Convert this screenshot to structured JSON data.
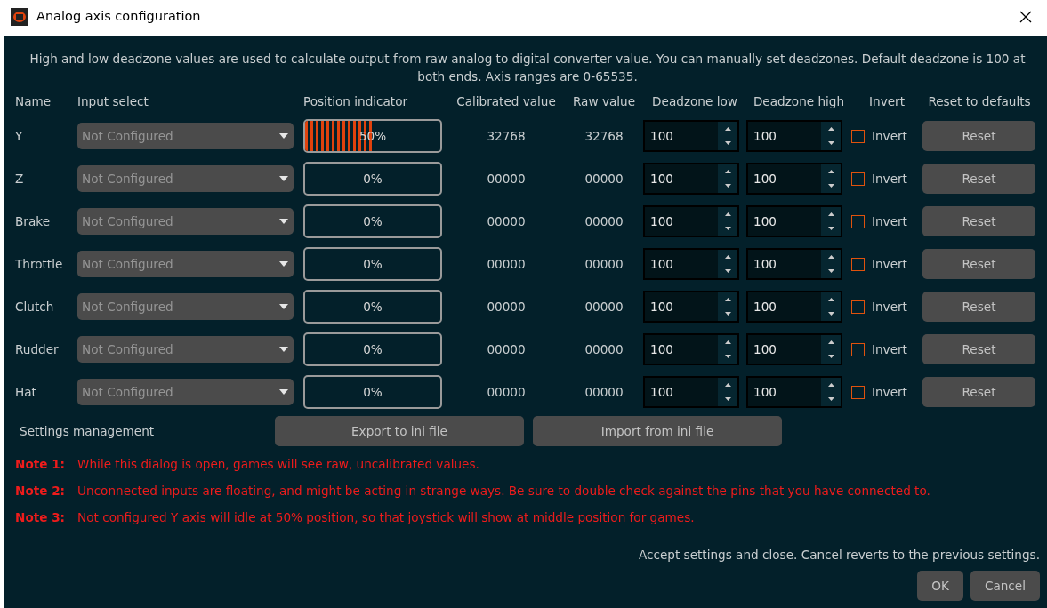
{
  "window": {
    "title": "Analog axis configuration"
  },
  "description": "High and low deadzone values are used to calculate output from raw analog to digital converter value. You can manually set deadzones. Default deadzone is 100 at both ends. Axis ranges are 0-65535.",
  "columns": [
    "Name",
    "Input select",
    "Position indicator",
    "Calibrated value",
    "Raw value",
    "Deadzone low",
    "Deadzone high",
    "Invert",
    "Reset to defaults"
  ],
  "axes": [
    {
      "name": "Y",
      "input": "Not Configured",
      "level": 0.5,
      "percent": "50%",
      "calibrated": "32768",
      "raw": "32768",
      "deadzone_low": "100",
      "deadzone_high": "100",
      "invert_label": "Invert",
      "checked": false,
      "reset": "Reset"
    },
    {
      "name": "Z",
      "input": "Not Configured",
      "level": 0,
      "percent": "0%",
      "calibrated": "00000",
      "raw": "00000",
      "deadzone_low": "100",
      "deadzone_high": "100",
      "invert_label": "Invert",
      "checked": false,
      "reset": "Reset"
    },
    {
      "name": "Brake",
      "input": "Not Configured",
      "level": 0,
      "percent": "0%",
      "calibrated": "00000",
      "raw": "00000",
      "deadzone_low": "100",
      "deadzone_high": "100",
      "invert_label": "Invert",
      "checked": false,
      "reset": "Reset"
    },
    {
      "name": "Throttle",
      "input": "Not Configured",
      "level": 0,
      "percent": "0%",
      "calibrated": "00000",
      "raw": "00000",
      "deadzone_low": "100",
      "deadzone_high": "100",
      "invert_label": "Invert",
      "checked": false,
      "reset": "Reset"
    },
    {
      "name": "Clutch",
      "input": "Not Configured",
      "level": 0,
      "percent": "0%",
      "calibrated": "00000",
      "raw": "00000",
      "deadzone_low": "100",
      "deadzone_high": "100",
      "invert_label": "Invert",
      "checked": false,
      "reset": "Reset"
    },
    {
      "name": "Rudder",
      "input": "Not Configured",
      "level": 0,
      "percent": "0%",
      "calibrated": "00000",
      "raw": "00000",
      "deadzone_low": "100",
      "deadzone_high": "100",
      "invert_label": "Invert",
      "checked": false,
      "reset": "Reset"
    },
    {
      "name": "Hat",
      "input": "Not Configured",
      "level": 0,
      "percent": "0%",
      "calibrated": "00000",
      "raw": "00000",
      "deadzone_low": "100",
      "deadzone_high": "100",
      "invert_label": "Invert",
      "checked": false,
      "reset": "Reset"
    }
  ],
  "settings": {
    "label": "Settings management",
    "buttons": [
      "Export to ini file",
      "Import from ini file"
    ]
  },
  "notes": [
    {
      "label": "Note 1:",
      "text": "While this dialog is open, games will see raw, uncalibrated values."
    },
    {
      "label": "Note 2:",
      "text": "Unconnected inputs are floating, and might be acting in strange ways. Be sure to double check against the pins that you have connected to."
    },
    {
      "label": "Note 3:",
      "text": "Not configured Y axis will idle at 50% position, so that joystick will show at middle position for games."
    }
  ],
  "footer": {
    "text": "Accept settings and close. Cancel reverts to the previous settings.",
    "buttons": [
      "OK",
      "Cancel"
    ]
  }
}
